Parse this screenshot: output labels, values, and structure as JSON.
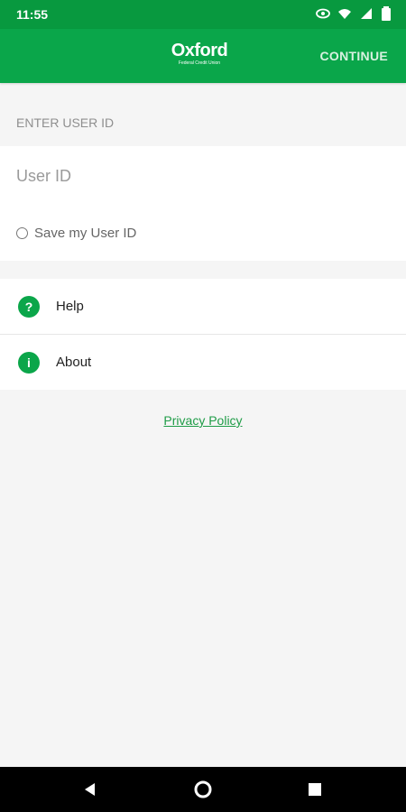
{
  "status_bar": {
    "time": "11:55",
    "icons": [
      "eye-icon",
      "wifi-icon",
      "signal-icon",
      "battery-icon"
    ]
  },
  "app_bar": {
    "logo_text": "Oxford",
    "logo_subtext": "Federal Credit Union",
    "continue_label": "CONTINUE"
  },
  "login": {
    "section_label": "ENTER USER ID",
    "user_id_placeholder": "User ID",
    "save_user_id_label": "Save my User ID"
  },
  "menu": {
    "items": [
      {
        "label": "Help",
        "icon": "?"
      },
      {
        "label": "About",
        "icon": "i"
      }
    ]
  },
  "footer": {
    "privacy_policy": "Privacy Policy"
  },
  "colors": {
    "primary": "#0aa64a",
    "status": "#08993f",
    "link": "#1f9c47"
  }
}
